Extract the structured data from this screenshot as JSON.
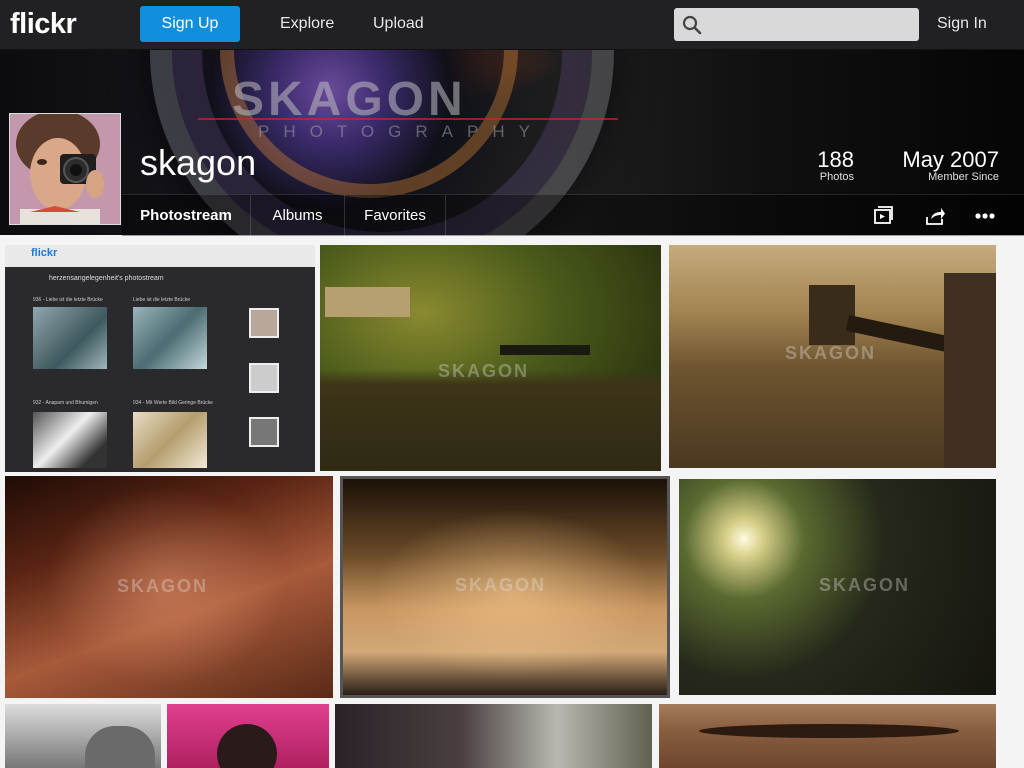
{
  "brand": {
    "logo": "flickr"
  },
  "topnav": {
    "signup_label": "Sign Up",
    "explore_label": "Explore",
    "upload_label": "Upload",
    "search_placeholder": "",
    "signin_label": "Sign In"
  },
  "cover": {
    "watermark_title": "SKAGON",
    "watermark_sub": "PHOTOGRAPHY"
  },
  "profile": {
    "username": "skagon",
    "photos_count": "188",
    "photos_label": "Photos",
    "member_since": "May 2007",
    "member_since_label": "Member Since"
  },
  "subnav": {
    "tabs": [
      {
        "label": "Photostream",
        "active": true
      },
      {
        "label": "Albums",
        "active": false
      },
      {
        "label": "Favorites",
        "active": false
      }
    ],
    "tools": [
      "slideshow-icon",
      "share-icon",
      "more-icon"
    ]
  },
  "photos": {
    "watermark": "SKAGON",
    "embedded_screenshot": {
      "logo": "flickr",
      "title": "herzensangelegenheit's photostream",
      "item1": "936 - Liebe ist die letzte Brücke",
      "item2": "Liebe ist die letzte Brücke",
      "item3": "932 - Anapam und Bhumigen",
      "item4": "934 - Mit Werte Bild Geringe Brücke"
    }
  },
  "colors": {
    "nav_bg": "#212124",
    "accent": "#128fdc",
    "page_bg": "#f4f4f4"
  }
}
